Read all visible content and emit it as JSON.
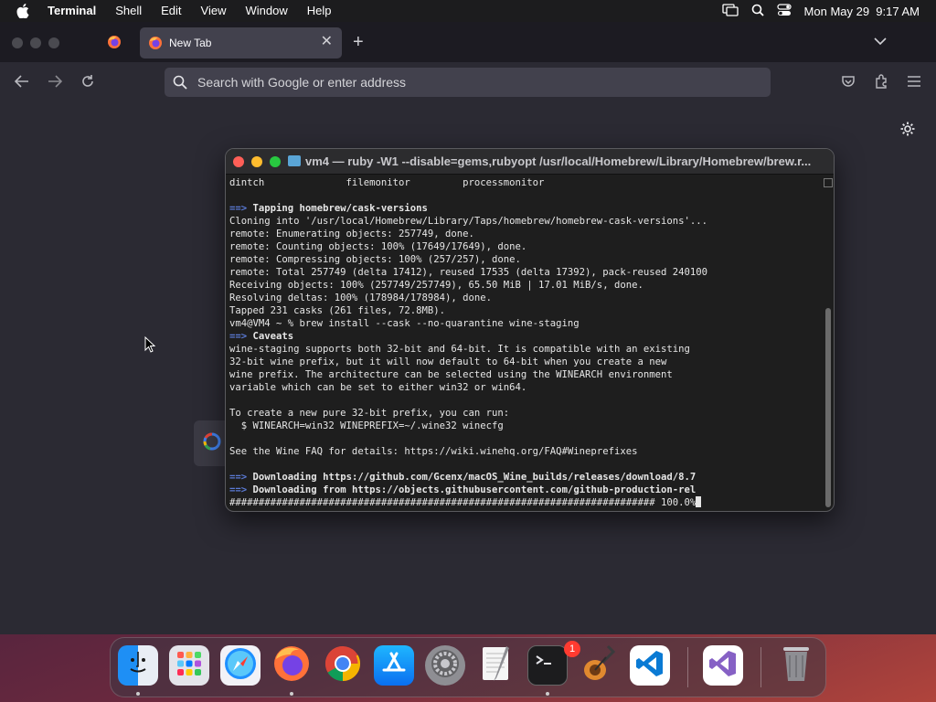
{
  "menubar": {
    "app_name": "Terminal",
    "items": [
      "Shell",
      "Edit",
      "View",
      "Window",
      "Help"
    ],
    "clock": "Mon May 29  9:17 AM"
  },
  "browser": {
    "active_tab_title": "New Tab",
    "url_placeholder": "Search with Google or enter address"
  },
  "terminal": {
    "title": "vm4 — ruby -W1 --disable=gems,rubyopt /usr/local/Homebrew/Library/Homebrew/brew.r...",
    "lines": [
      {
        "t": "dintch              filemonitor         processmonitor"
      },
      {
        "t": ""
      },
      {
        "a": "==>",
        "t": "Tapping homebrew/cask-versions",
        "bold": true
      },
      {
        "t": "Cloning into '/usr/local/Homebrew/Library/Taps/homebrew/homebrew-cask-versions'..."
      },
      {
        "t": "remote: Enumerating objects: 257749, done."
      },
      {
        "t": "remote: Counting objects: 100% (17649/17649), done."
      },
      {
        "t": "remote: Compressing objects: 100% (257/257), done."
      },
      {
        "t": "remote: Total 257749 (delta 17412), reused 17535 (delta 17392), pack-reused 240100"
      },
      {
        "t": "Receiving objects: 100% (257749/257749), 65.50 MiB | 17.01 MiB/s, done."
      },
      {
        "t": "Resolving deltas: 100% (178984/178984), done."
      },
      {
        "t": "Tapped 231 casks (261 files, 72.8MB)."
      },
      {
        "t": "vm4@VM4 ~ % brew install --cask --no-quarantine wine-staging"
      },
      {
        "a": "==>",
        "t": "Caveats",
        "bold": true
      },
      {
        "t": "wine-staging supports both 32-bit and 64-bit. It is compatible with an existing"
      },
      {
        "t": "32-bit wine prefix, but it will now default to 64-bit when you create a new"
      },
      {
        "t": "wine prefix. The architecture can be selected using the WINEARCH environment"
      },
      {
        "t": "variable which can be set to either win32 or win64."
      },
      {
        "t": ""
      },
      {
        "t": "To create a new pure 32-bit prefix, you can run:"
      },
      {
        "t": "  $ WINEARCH=win32 WINEPREFIX=~/.wine32 winecfg"
      },
      {
        "t": ""
      },
      {
        "t": "See the Wine FAQ for details: https://wiki.winehq.org/FAQ#Wineprefixes"
      },
      {
        "t": ""
      },
      {
        "a": "==>",
        "t": "Downloading https://github.com/Gcenx/macOS_Wine_builds/releases/download/8.7",
        "bold": true
      },
      {
        "a": "==>",
        "t": "Downloading from https://objects.githubusercontent.com/github-production-rel",
        "bold": true
      },
      {
        "t": "######################################################################### 100.0%",
        "cursor": true
      }
    ]
  },
  "dock": {
    "items": [
      "Finder",
      "Launchpad",
      "Safari",
      "Firefox",
      "Google Chrome",
      "App Store",
      "System Settings",
      "TextEdit",
      "Terminal",
      "GarageBand",
      "Visual Studio Code",
      "Visual Studio",
      "Trash"
    ],
    "settings_badge": "1"
  },
  "colors": {
    "menubar": "#1c1c1e",
    "browser_bg": "#2b2a33",
    "tab_active": "#42414d",
    "terminal_bg": "#1e1e1e",
    "terminal_arrow": "#5b7bd6",
    "close": "#ff5f57",
    "minimize": "#febc2e",
    "zoom": "#28c840"
  }
}
